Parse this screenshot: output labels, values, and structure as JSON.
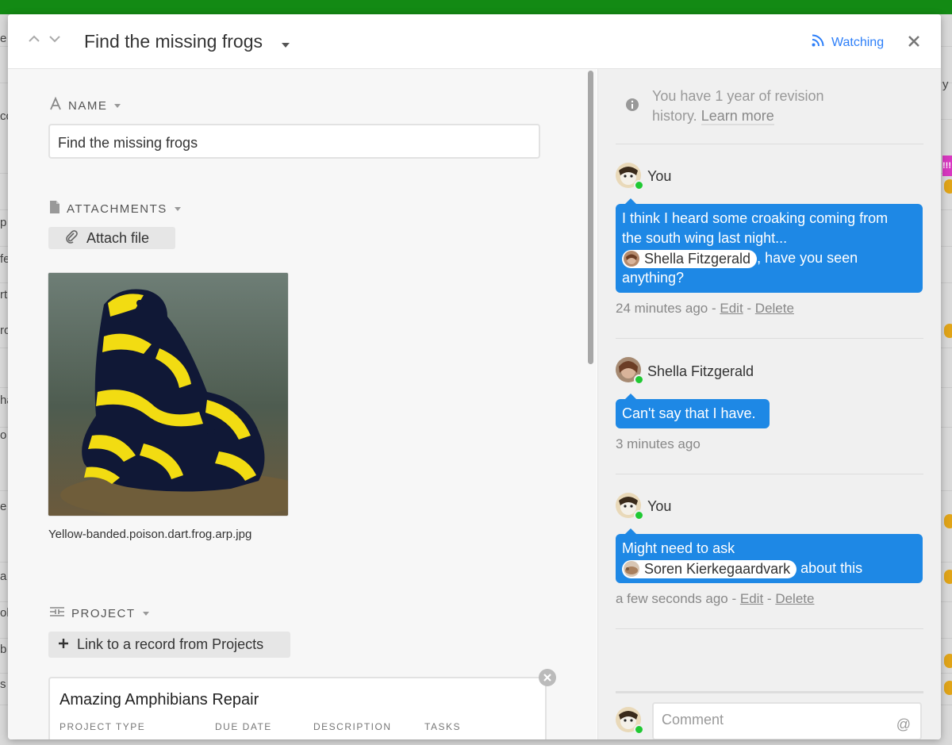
{
  "background": {
    "left_fragments": [
      "e",
      "cc",
      "p",
      "fe",
      "rt",
      "ro",
      "ha",
      "o i",
      "e",
      "a",
      "ol",
      "b",
      "s"
    ],
    "right_badge": "!!!",
    "right_fragment": "y"
  },
  "header": {
    "title": "Find the missing frogs",
    "watching_label": "Watching",
    "watching_icon": "rss-icon",
    "close_icon": "close-icon",
    "accent_color": "#2d7ff9"
  },
  "fields": {
    "name": {
      "label": "NAME",
      "value": "Find the missing frogs"
    },
    "attachments": {
      "label": "ATTACHMENTS",
      "attach_button": "Attach file",
      "filename": "Yellow-banded.poison.dart.frog.arp.jpg"
    },
    "project": {
      "label": "PROJECT",
      "link_button": "Link to a record from Projects",
      "card": {
        "title": "Amazing Amphibians Repair",
        "columns": [
          "PROJECT TYPE",
          "DUE DATE",
          "DESCRIPTION",
          "TASKS"
        ]
      }
    }
  },
  "activity": {
    "revision_info": {
      "text": "You have 1 year of revision history.",
      "link": "Learn more"
    },
    "comments": [
      {
        "author": "You",
        "line1": "I think I heard some croaking coming from",
        "line2": "the south wing last night...",
        "mention": "Shella Fitzgerald",
        "line3_after": ", have you seen",
        "line4": "anything?",
        "time": "24 minutes ago",
        "edit": "Edit",
        "delete": "Delete"
      },
      {
        "author": "Shella Fitzgerald",
        "text": "Can't say that I have.",
        "time": "3 minutes ago"
      },
      {
        "author": "You",
        "line1": "Might need to ask",
        "mention": "Soren Kierkegaardvark",
        "line2_after": " about this",
        "time": "a few seconds ago",
        "edit": "Edit",
        "delete": "Delete"
      }
    ],
    "comment_input": {
      "placeholder": "Comment",
      "at_symbol": "@"
    },
    "bubble_color": "#1e88e5",
    "online_color": "#20c933"
  }
}
